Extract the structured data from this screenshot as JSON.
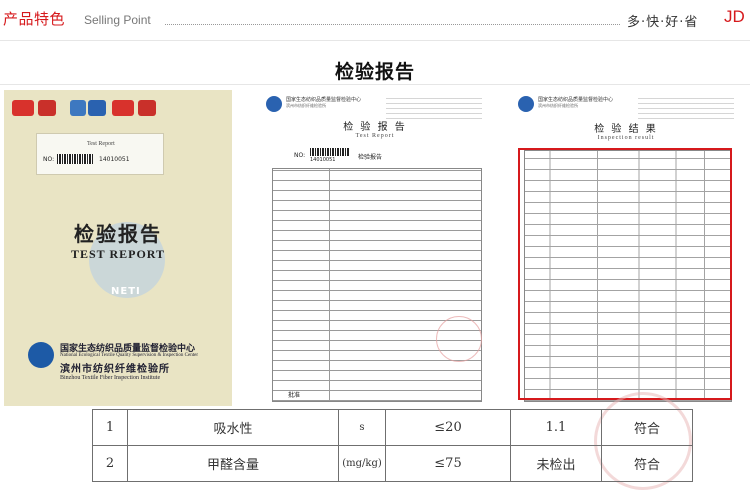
{
  "header": {
    "title": "产品特色",
    "subtitle": "Selling Point",
    "slogan": "多·快·好·省",
    "brand": "JD"
  },
  "section_title": "检验报告",
  "booklet": {
    "cert_marks": [
      "MA",
      "CAL",
      "MA",
      "CAL"
    ],
    "label_title": "Test Report",
    "label_no": "NO:",
    "label_no_value": "14010051",
    "title_cn": "检验报告",
    "title_en": "TEST REPORT",
    "watermark": "NETI",
    "org_cn": "国家生态纺织品质量监督检验中心",
    "org_en": "National Ecological Textile Quality Supervision & Inspection Center",
    "branch_cn": "滨州市纺织纤维检验所",
    "branch_en": "Binzhou Textile Fiber Inspection Institute"
  },
  "report_page": {
    "title": "检 验 报 告",
    "subtitle": "Test Report",
    "no": "NO:",
    "no_value": "14010051",
    "sample_label": "检验报告",
    "approve_label": "批准"
  },
  "result_page": {
    "title": "检 验 结 果",
    "subtitle": "Inspection result"
  },
  "results_table": {
    "rows": [
      {
        "no": "1",
        "item": "吸水性",
        "unit": "s",
        "standard": "≤20",
        "result": "1.1",
        "verdict": "符合"
      },
      {
        "no": "2",
        "item": "甲醛含量",
        "unit": "(mg/kg)",
        "standard": "≤75",
        "result": "未检出",
        "verdict": "符合"
      }
    ]
  },
  "colors": {
    "accent": "#d6191c",
    "booklet": "#e9e4c4",
    "highlight": "#d6191c"
  }
}
